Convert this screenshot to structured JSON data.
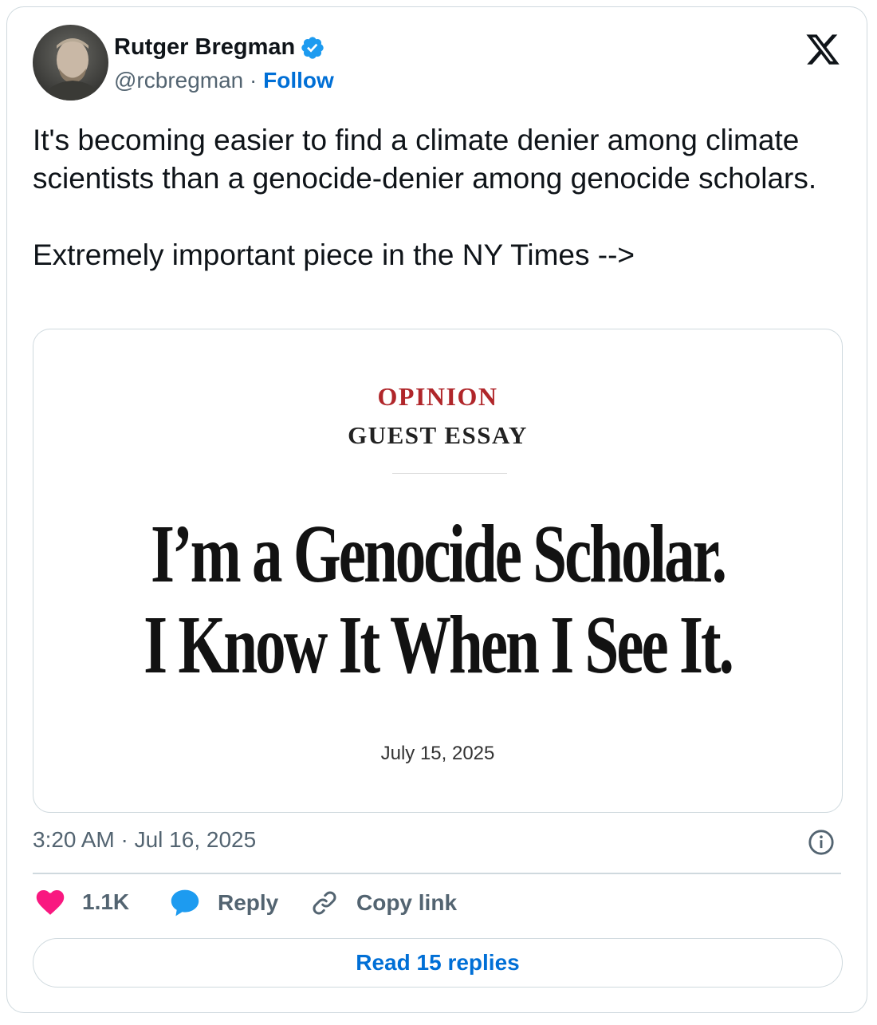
{
  "author": {
    "display_name": "Rutger Bregman",
    "handle": "@rcbregman",
    "separator": " · ",
    "follow_label": "Follow",
    "verified": true
  },
  "tweet": {
    "paragraphs": [
      "It's becoming easier to find a climate denier among climate scientists than a genocide-denier among genocide scholars.",
      "Extremely important piece in the NY Times -->"
    ],
    "timestamp": "3:20 AM · Jul 16, 2025"
  },
  "card": {
    "section": "OPINION",
    "label": "GUEST ESSAY",
    "headline_lines": [
      "I’m a Genocide Scholar.",
      "I Know It When I See It."
    ],
    "date": "July 15, 2025"
  },
  "actions": {
    "like_count": "1.1K",
    "reply_label": "Reply",
    "copy_label": "Copy link"
  },
  "read_replies_label": "Read 15 replies",
  "colors": {
    "link_blue": "#006fd6",
    "verified_blue": "#1d9bf0",
    "like_pink": "#f91880",
    "reply_blue": "#1d9bf0",
    "opinion_red": "#b0262a",
    "muted_gray": "#536471",
    "border": "#cfd9de"
  },
  "icons": [
    "verified-badge-icon",
    "x-logo-icon",
    "info-icon",
    "heart-icon",
    "reply-bubble-icon",
    "link-icon"
  ]
}
